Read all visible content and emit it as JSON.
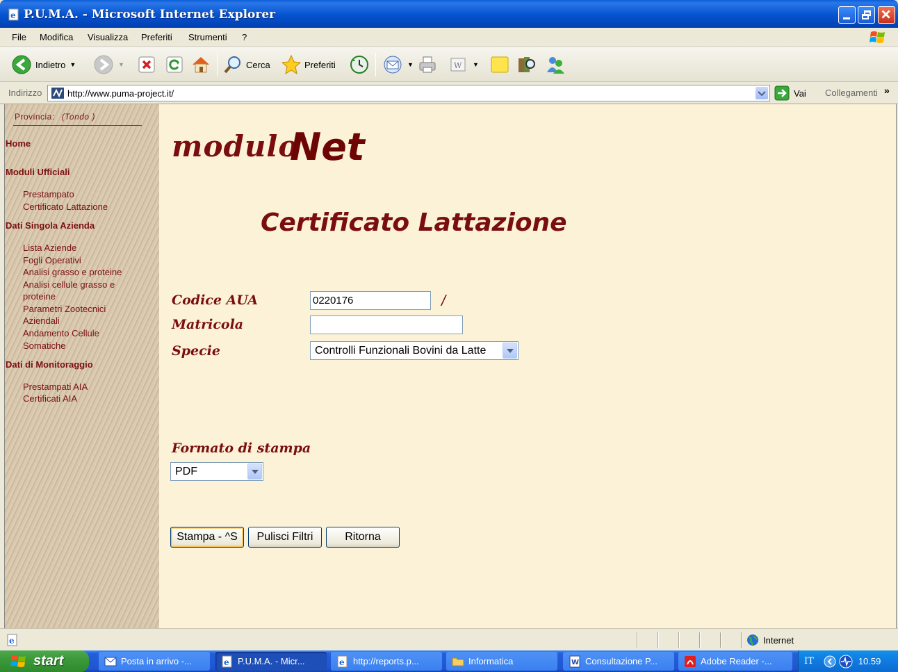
{
  "window": {
    "title": "P.U.M.A. - Microsoft Internet Explorer"
  },
  "menu": {
    "items": [
      "File",
      "Modifica",
      "Visualizza",
      "Preferiti",
      "Strumenti",
      "?"
    ]
  },
  "toolbar": {
    "back_label": "Indietro",
    "search_label": "Cerca",
    "favorites_label": "Preferiti"
  },
  "address": {
    "label": "Indirizzo",
    "url": "http://www.puma-project.it/",
    "go_label": "Vai",
    "links_label": "Collegamenti"
  },
  "sidebar": {
    "provincia_label": "Provincia:",
    "provincia_value": "(Tondo )",
    "home": "Home",
    "sections": [
      {
        "title": "Moduli Ufficiali",
        "links": [
          "Prestampato",
          "Certificato Lattazione"
        ]
      },
      {
        "title": "Dati Singola Azienda",
        "links": [
          "Lista Aziende",
          "Fogli Operativi",
          "Analisi grasso e proteine",
          "Analisi cellule grasso e",
          "proteine",
          "Parametri Zootecnici",
          "Aziendali",
          "Andamento Cellule",
          "Somatiche"
        ]
      },
      {
        "title": "Dati di Monitoraggio",
        "links": [
          "Prestampati AIA",
          "Certificati AIA"
        ]
      }
    ]
  },
  "main": {
    "logo_modulo": "modulo",
    "logo_net": "Net",
    "title": "Certificato Lattazione",
    "form": {
      "codice_label": "Codice AUA",
      "codice_value": "0220176",
      "slash": "/",
      "matricola_label": "Matricola",
      "matricola_value": "",
      "specie_label": "Specie",
      "specie_value": "Controlli Funzionali Bovini da Latte",
      "formato_label": "Formato di stampa",
      "formato_value": "PDF"
    },
    "buttons": {
      "stampa": "Stampa - ^S",
      "pulisci": "Pulisci Filtri",
      "ritorna": "Ritorna"
    }
  },
  "status": {
    "zone": "Internet"
  },
  "taskbar": {
    "start": "start",
    "tasks": [
      "Posta in arrivo -...",
      "P.U.M.A. - Micr...",
      "http://reports.p...",
      "Informatica",
      "Consultazione P...",
      "Adobe Reader -..."
    ],
    "lang": "IT",
    "clock": "10.59"
  },
  "colors": {
    "accent": "#7a0e0e",
    "content_bg": "#fcf2d8",
    "sidebar_bg": "#d6c3a5",
    "titlebar": "#0552d0"
  }
}
